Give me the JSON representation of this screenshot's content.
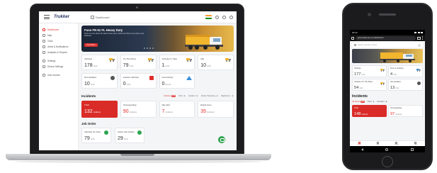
{
  "colors": {
    "accent": "#e0312e",
    "navy": "#1f2c59",
    "success": "#2ea44f"
  },
  "desktop": {
    "logo": "Trukker",
    "breadcrumb": "Dashboard",
    "sidebar": [
      {
        "label": "Dashboard",
        "icon": "grid-icon",
        "active": true
      },
      {
        "label": "Map",
        "icon": "map-icon"
      },
      {
        "label": "Tools",
        "icon": "wrench-icon"
      },
      {
        "label": "Alerts & Notifications",
        "icon": "bell-icon"
      },
      {
        "label": "Analytics & Reports",
        "icon": "chart-icon"
      },
      {
        "label": "Settings",
        "icon": "gear-icon"
      },
      {
        "label": "Device Settings",
        "icon": "device-icon"
      },
      {
        "label": "User Access",
        "icon": "user-icon"
      }
    ],
    "hero": {
      "title": "Fuso FN 61 FL Heavy Duty",
      "subtitle": "Find out more about the latest heavy duty vehicle and how it can power your business.",
      "button": "Know More"
    },
    "stats": [
      {
        "label": "Vehicles",
        "value": "178",
        "unit": "Units",
        "icon": "truck-icon"
      },
      {
        "label": "On The Move",
        "value": "79",
        "unit": "Units",
        "icon": "truck-icon"
      },
      {
        "label": "Vehicles In Stop",
        "value": "1",
        "unit": "Units",
        "icon": "truck-icon"
      },
      {
        "label": "Idle",
        "value": "10",
        "unit": "Units",
        "icon": "truck-icon"
      },
      {
        "label": "Not Updated",
        "value": "10",
        "unit": "Units",
        "icon": "clock-icon"
      },
      {
        "label": "Inactive Vehicles",
        "value": "0",
        "unit": "Units",
        "icon": "alert-icon"
      },
      {
        "label": "Fuel Activity",
        "value": "0",
        "unit": "Events",
        "icon": "warning-icon"
      }
    ],
    "incidents": {
      "title": "Incidents",
      "filters": [
        {
          "label": "All Alerts",
          "count": "138",
          "active": true
        },
        {
          "label": "Theft",
          "count": "0"
        },
        {
          "label": "Accident",
          "count": "0"
        },
        {
          "label": "Device Tampering",
          "count": "0"
        },
        {
          "label": "Rapid Acce.",
          "count": "0"
        }
      ],
      "cards": [
        {
          "label": "Theft",
          "value": "132",
          "unit": "Incidents",
          "highlight": true
        },
        {
          "label": "Overspeeding",
          "value": "90",
          "unit": "Incidents"
        },
        {
          "label": "Idle Alert",
          "value": "7",
          "unit": "Incidents"
        },
        {
          "label": "Rapid Acce.",
          "value": "35",
          "unit": "Incidents"
        }
      ]
    },
    "job_orders": {
      "title": "Job Order",
      "cards": [
        {
          "label": "Vehicles On Duty",
          "value": "79",
          "unit": "Units"
        },
        {
          "label": "Active Job Orders",
          "value": "29",
          "unit": "Units"
        }
      ]
    }
  },
  "mobile": {
    "status_time": "10:14",
    "url": "pwa.trukkeruae.com/dashboard",
    "tab_count": "2",
    "search_placeholder": "Search vehicle or driver",
    "stats": [
      {
        "label": "Vehicles",
        "value": "177",
        "unit": "Units",
        "icon": "truck-icon"
      },
      {
        "label": "Zone & Vehicles",
        "value": "4",
        "unit": "Units",
        "icon": "truck-icon"
      },
      {
        "label": "Vehicles On The Move",
        "value": "54",
        "unit": "Units",
        "icon": "truck-icon"
      },
      {
        "label": "Not Updated",
        "value": "13",
        "unit": "Units",
        "icon": "clock-icon"
      }
    ],
    "incidents": {
      "title": "Incidents",
      "filters": [
        {
          "label": "All Alerts",
          "count": "280",
          "active": true
        },
        {
          "label": "Theft",
          "count": "1"
        },
        {
          "label": "Accident",
          "count": "0"
        }
      ],
      "cards": [
        {
          "label": "Theft",
          "value": "148",
          "unit": "Incidents",
          "highlight": true
        },
        {
          "label": "Overspeeding",
          "value": "97",
          "unit": "Incidents"
        }
      ]
    },
    "bottom_nav": [
      "Home",
      "Map",
      "Reports",
      "More"
    ]
  }
}
